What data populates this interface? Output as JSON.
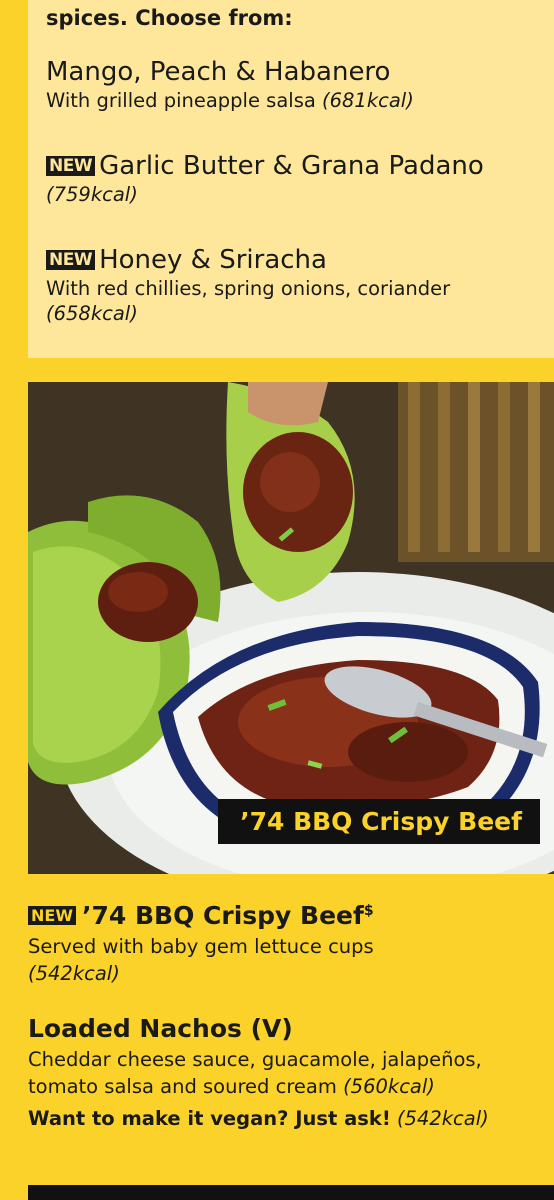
{
  "top_section": {
    "intro": "spices. Choose from:",
    "items": [
      {
        "name": "Mango, Peach & Habanero",
        "desc": "With grilled pineapple salsa ",
        "kcal": "(681kcal)",
        "is_new": false
      },
      {
        "name": "Garlic Butter & Grana Padano",
        "desc": "",
        "kcal": "(759kcal)",
        "is_new": true
      },
      {
        "name": "Honey & Sriracha",
        "desc": "With red chillies, spring onions, coriander",
        "kcal": "(658kcal)",
        "is_new": true
      }
    ],
    "new_badge": "NEW"
  },
  "photo": {
    "caption": "’74 BBQ Crispy Beef"
  },
  "menu": {
    "beef": {
      "badge": "NEW",
      "name": "’74 BBQ Crispy Beef",
      "marker": "$",
      "desc": "Served with baby gem lettuce cups",
      "kcal": "(542kcal)"
    },
    "nachos": {
      "name": "Loaded Nachos (V)",
      "desc_line1": "Cheddar cheese sauce, guacamole, jalapeños,",
      "desc_line2": "tomato salsa and soured cream ",
      "kcal": "(560kcal)",
      "vegan_prompt": "Want to make it vegan? Just ask!",
      "vegan_kcal": "(542kcal)"
    }
  },
  "colors": {
    "page_yellow": "#FBD22A",
    "box_cream": "#FEE79A",
    "badge_black": "#1a1a1a"
  }
}
